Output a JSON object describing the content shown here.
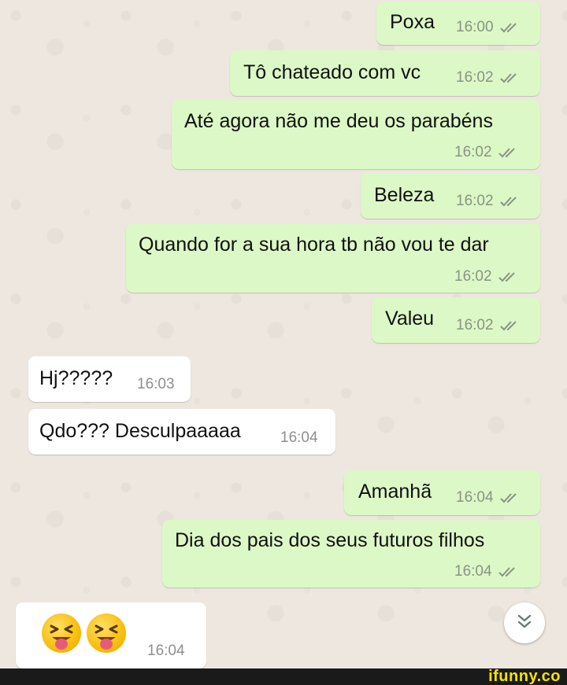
{
  "colors": {
    "outgoing_bubble": "#DCF8C6",
    "incoming_bubble": "#FFFFFF",
    "chat_background": "#EDE7DF",
    "tick_color": "#8A9384",
    "brand_color": "#F6E400"
  },
  "messages": [
    {
      "direction": "out",
      "text": "Poxa",
      "time": "16:00",
      "ticks": "double-check-icon"
    },
    {
      "direction": "out",
      "text": "Tô chateado com vc",
      "time": "16:02",
      "ticks": "double-check-icon"
    },
    {
      "direction": "out",
      "text": "Até agora não me deu os parabéns",
      "time": "16:02",
      "ticks": "double-check-icon"
    },
    {
      "direction": "out",
      "text": "Beleza",
      "time": "16:02",
      "ticks": "double-check-icon"
    },
    {
      "direction": "out",
      "text": "Quando for a sua hora tb não vou te dar",
      "time": "16:02",
      "ticks": "double-check-icon"
    },
    {
      "direction": "out",
      "text": "Valeu",
      "time": "16:02",
      "ticks": "double-check-icon"
    },
    {
      "direction": "in",
      "text": "Hj?????",
      "time": "16:03"
    },
    {
      "direction": "in",
      "text": "Qdo??? Desculpaaaaa",
      "time": "16:04"
    },
    {
      "direction": "out",
      "text": "Amanhã",
      "time": "16:04",
      "ticks": "double-check-icon"
    },
    {
      "direction": "out",
      "text": "Dia dos pais dos seus futuros filhos",
      "time": "16:04",
      "ticks": "double-check-icon"
    },
    {
      "direction": "in",
      "emoji": [
        "squinting-face-with-tongue-emoji",
        "squinting-face-with-tongue-emoji"
      ],
      "time": "16:04"
    }
  ],
  "scroll_button": {
    "icon": "double-chevron-down-icon"
  },
  "footer": {
    "brand": "ifunny.co"
  }
}
